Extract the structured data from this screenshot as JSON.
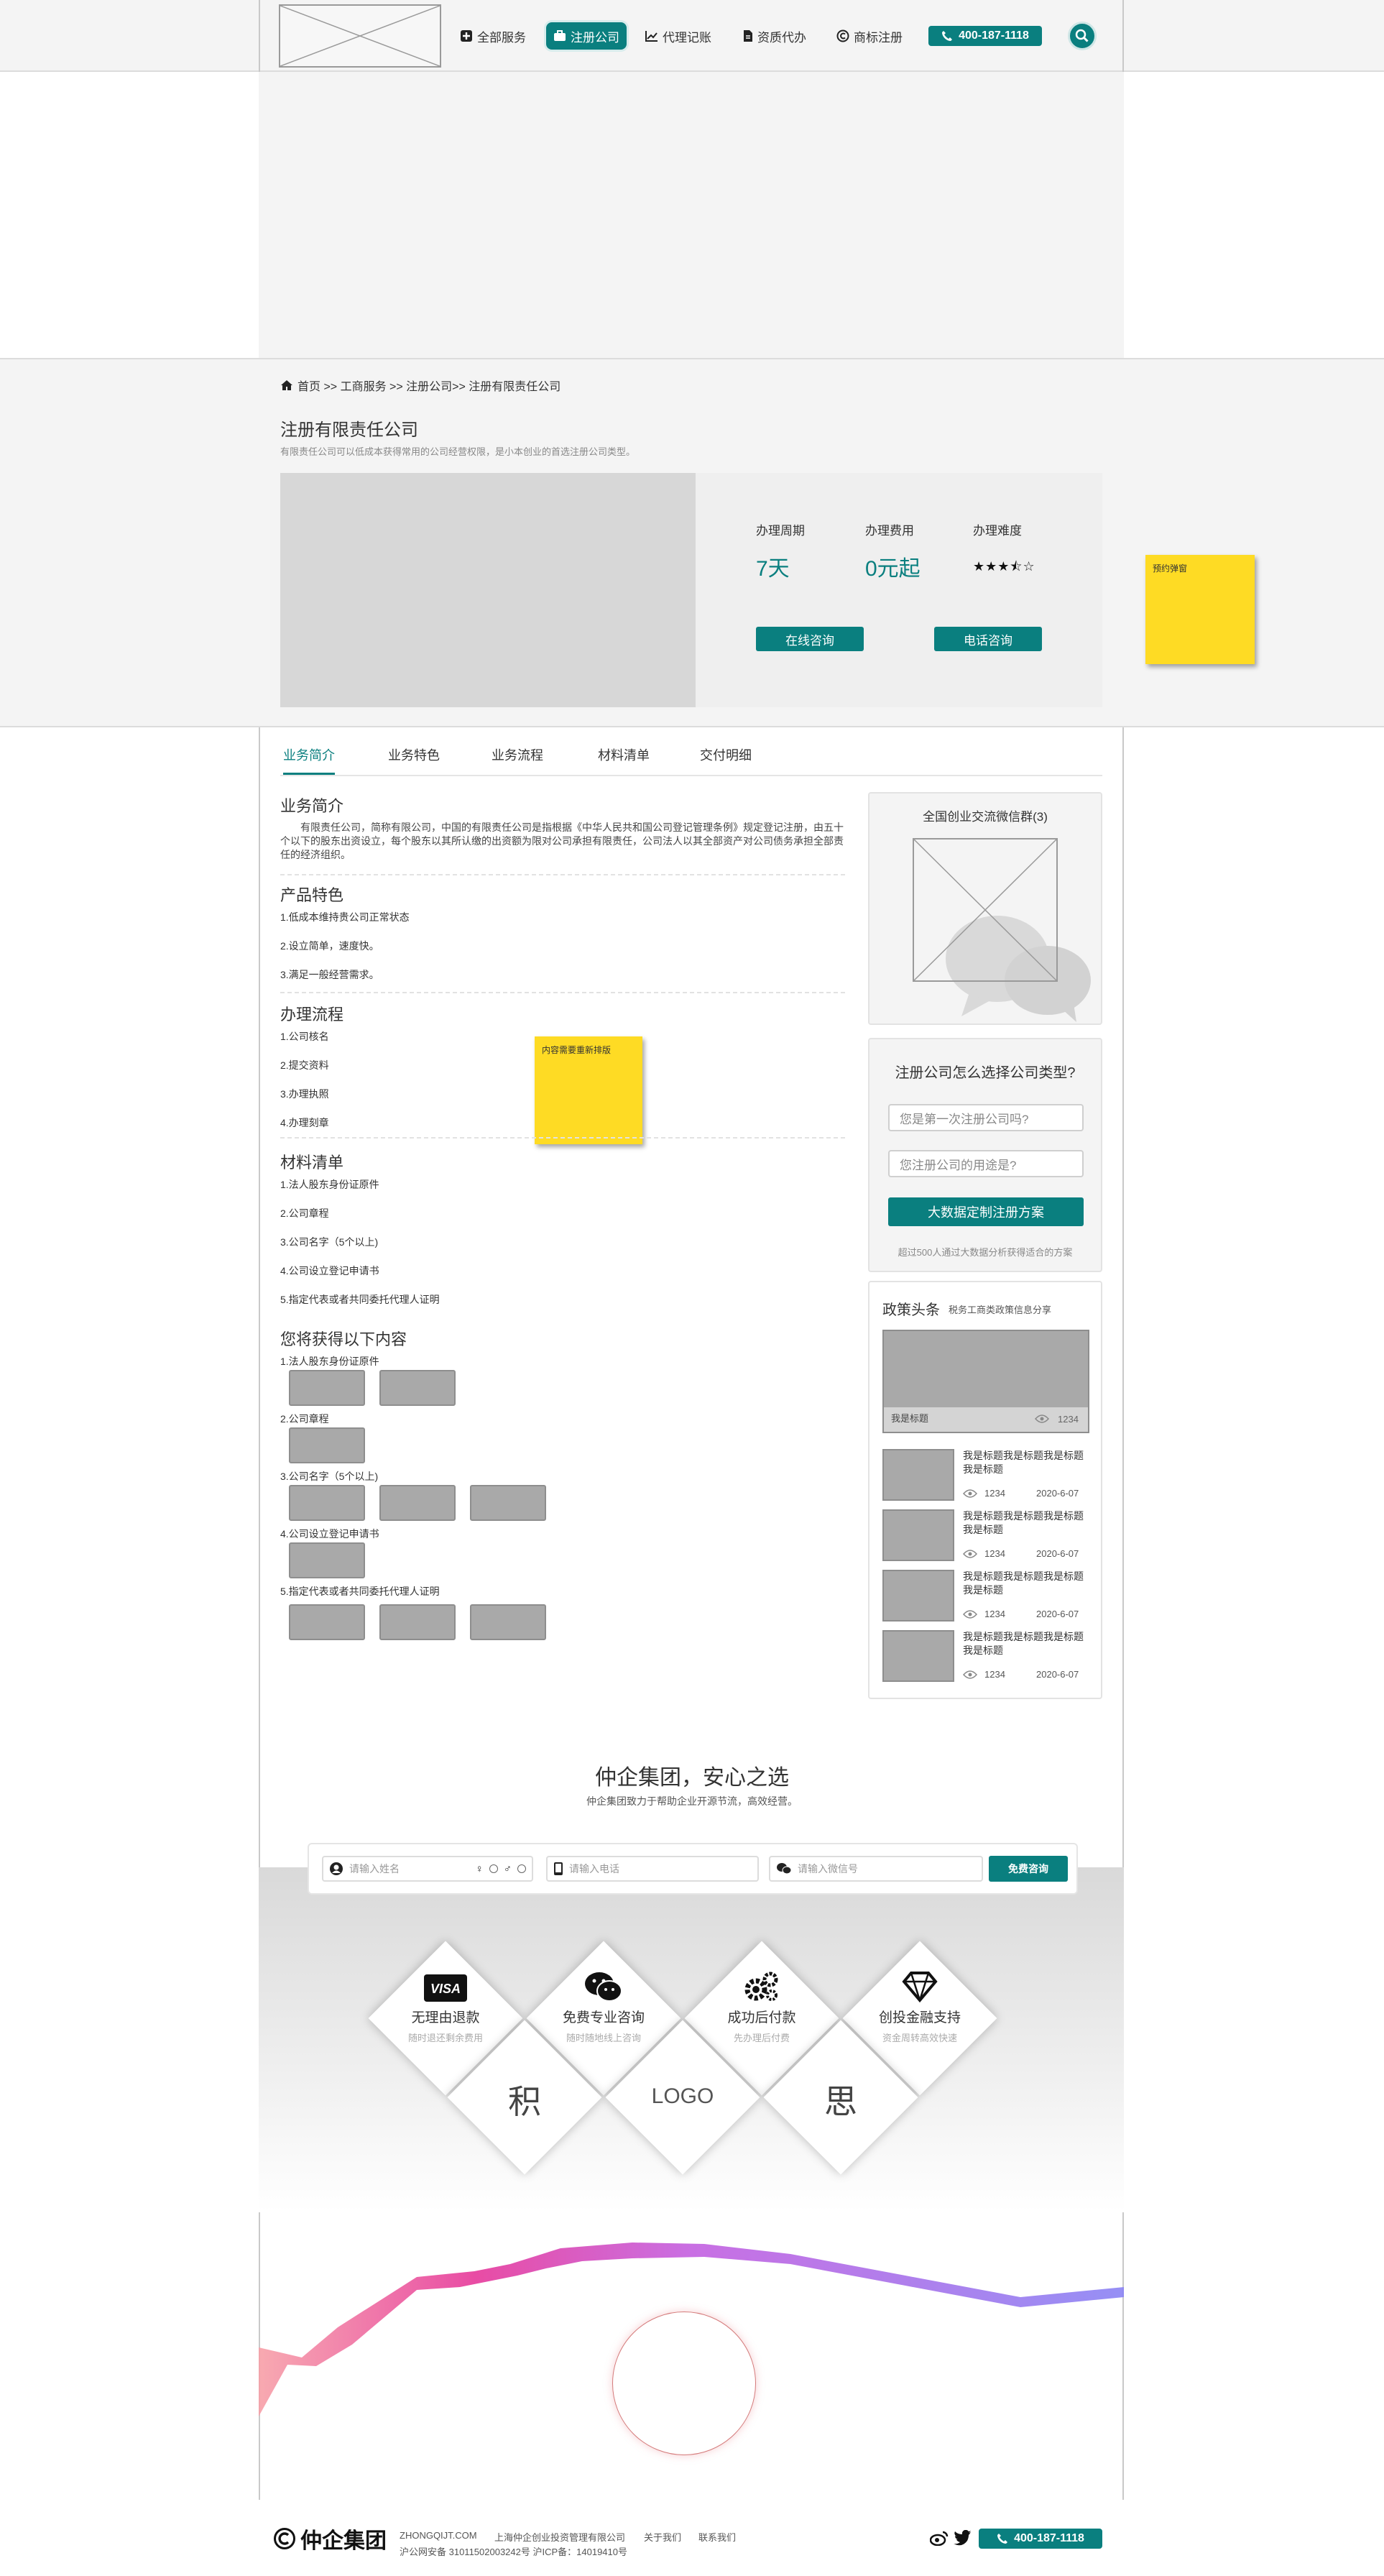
{
  "header": {
    "nav": [
      {
        "label": "全部服务",
        "icon": "plus-square-icon"
      },
      {
        "label": "注册公司",
        "icon": "briefcase-icon",
        "active": true
      },
      {
        "label": "代理记账",
        "icon": "line-chart-icon"
      },
      {
        "label": "资质代办",
        "icon": "document-icon"
      },
      {
        "label": "商标注册",
        "icon": "copyright-icon"
      }
    ],
    "phone": "400-187-1118"
  },
  "breadcrumb": "首页 >> 工商服务 >> 注册公司>> 注册有限责任公司",
  "product": {
    "title": "注册有限责任公司",
    "subtitle": "有限责任公司可以低成本获得常用的公司经营权限，是小本创业的首选注册公司类型。",
    "cycle_label": "办理周期",
    "cycle_value": "7天",
    "fee_label": "办理费用",
    "fee_value": "0元起",
    "difficulty_label": "办理难度",
    "difficulty_stars": 3.5,
    "btn_online": "在线咨询",
    "btn_phone": "电话咨询"
  },
  "notes": {
    "popup": "预约弹窗",
    "content": "内容需要重新排版"
  },
  "tabs": [
    "业务简介",
    "业务特色",
    "业务流程",
    "材料清单",
    "交付明细"
  ],
  "intro": {
    "title": "业务简介",
    "text": "有限责任公司，简称有限公司，中国的有限责任公司是指根据《中华人民共和国公司登记管理条例》规定登记注册，由五十个以下的股东出资设立，每个股东以其所认缴的出资额为限对公司承担有限责任，公司法人以其全部资产对公司债务承担全部责任的经济组织。"
  },
  "features": {
    "title": "产品特色",
    "items": [
      "1.低成本维持贵公司正常状态",
      "2.设立简单，速度快。",
      "3.满足一般经营需求。"
    ]
  },
  "process": {
    "title": "办理流程",
    "items": [
      "1.公司核名",
      "2.提交资料",
      "3.办理执照",
      "4.办理刻章"
    ]
  },
  "materials": {
    "title": "材料清单",
    "items": [
      "1.法人股东身份证原件",
      "2.公司章程",
      "3.公司名字（5个以上)",
      "4.公司设立登记申请书",
      "5.指定代表或者共同委托代理人证明"
    ]
  },
  "deliverables": {
    "title": "您将获得以下内容",
    "items": [
      {
        "label": "1.法人股东身份证原件",
        "count": 2
      },
      {
        "label": "2.公司章程",
        "count": 1
      },
      {
        "label": "3.公司名字（5个以上)",
        "count": 3
      },
      {
        "label": "4.公司设立登记申请书",
        "count": 1
      },
      {
        "label": "5.指定代表或者共同委托代理人证明",
        "count": 3
      }
    ]
  },
  "sidebar": {
    "wechat_title": "全国创业交流微信群(3)",
    "choose": {
      "title": "注册公司怎么选择公司类型?",
      "q1": "您是第一次注册公司吗?",
      "q2": "您注册公司的用途是?",
      "btn": "大数据定制注册方案",
      "note": "超过500人通过大数据分析获得适合的方案"
    },
    "news": {
      "title": "政策头条",
      "subtitle": "税务工商类政策信息分享",
      "featured_caption": "我是标题",
      "featured_views": "1234",
      "items": [
        {
          "title": "我是标题我是标题我是标题我是标题",
          "views": "1234",
          "date": "2020-6-07"
        },
        {
          "title": "我是标题我是标题我是标题我是标题",
          "views": "1234",
          "date": "2020-6-07"
        },
        {
          "title": "我是标题我是标题我是标题我是标题",
          "views": "1234",
          "date": "2020-6-07"
        },
        {
          "title": "我是标题我是标题我是标题我是标题",
          "views": "1234",
          "date": "2020-6-07"
        }
      ]
    }
  },
  "promo": {
    "slogan": "仲企集团，安心之选",
    "sub": "仲企集团致力于帮助企业开源节流，高效经营。",
    "name_placeholder": "请输入姓名",
    "phone_placeholder": "请输入电话",
    "wechat_placeholder": "请输入微信号",
    "submit": "免费咨询"
  },
  "diamonds": [
    {
      "icon": "visa-icon",
      "title": "无理由退款",
      "sub": "随时退还剩余费用"
    },
    {
      "icon": "wechat-icon",
      "title": "免费专业咨询",
      "sub": "随时随地线上咨询"
    },
    {
      "icon": "gears-icon",
      "title": "成功后付款",
      "sub": "先办理后付费"
    },
    {
      "icon": "diamond-icon",
      "title": "创投金融支持",
      "sub": "资金周转高效快速"
    }
  ],
  "diamond_chars": {
    "left": "积",
    "center": "LOGO",
    "right": "思"
  },
  "footer": {
    "brand": "仲企集团",
    "domain": "ZHONGQIJT.COM",
    "company": "上海仲企创业投资管理有限公司",
    "about": "关于我们",
    "contact": "联系我们",
    "icp": "沪公网安备 31011502003242号 沪ICP备：14019410号",
    "phone": "400-187-1118"
  }
}
